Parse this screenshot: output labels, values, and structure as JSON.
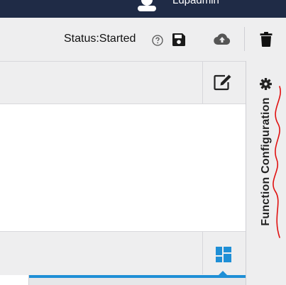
{
  "topbar": {
    "username": "Ldpadmin",
    "avatar_icon": "user-avatar-icon"
  },
  "toolbar": {
    "status_text": "Status:Started",
    "help_icon": "question-circle-icon",
    "save_icon": "floppy-disk-icon",
    "upload_icon": "cloud-upload-icon",
    "delete_icon": "trash-icon"
  },
  "panel": {
    "edit_icon": "edit-pencil-icon",
    "layout_icon": "dashboard-grid-icon"
  },
  "side_panel": {
    "gear_icon": "gear-icon",
    "label": "Function Configuration"
  },
  "colors": {
    "topbar": "#1f2b46",
    "panel_bg": "#eeeeef",
    "accent": "#1f8fd6",
    "layout_icon": "#1f8fd6",
    "annotation": "#e01010"
  }
}
